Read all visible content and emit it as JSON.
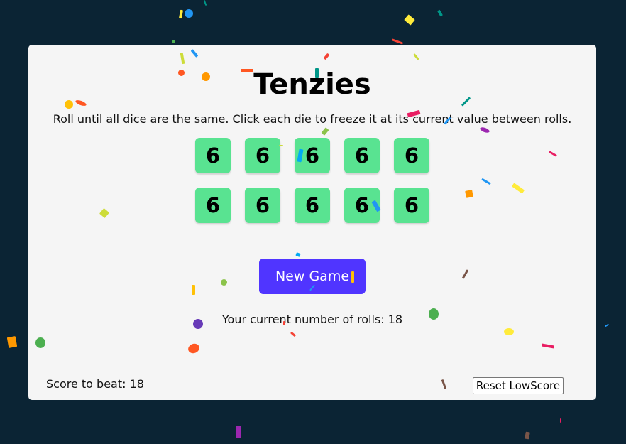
{
  "app": {
    "title": "Tenzies",
    "instructions": "Roll until all dice are the same. Click each die to freeze it at its current value between rolls."
  },
  "dice": [
    {
      "value": "6"
    },
    {
      "value": "6"
    },
    {
      "value": "6"
    },
    {
      "value": "6"
    },
    {
      "value": "6"
    },
    {
      "value": "6"
    },
    {
      "value": "6"
    },
    {
      "value": "6"
    },
    {
      "value": "6"
    },
    {
      "value": "6"
    }
  ],
  "controls": {
    "new_game_label": "New Game",
    "reset_label": "Reset LowScore"
  },
  "stats": {
    "rolls_text": "Your current number of rolls: 18",
    "score_text": "Score to beat: 18"
  },
  "colors": {
    "background": "#0b2434",
    "card": "#f5f5f5",
    "die_held": "#59e391",
    "button": "#5035ff"
  }
}
